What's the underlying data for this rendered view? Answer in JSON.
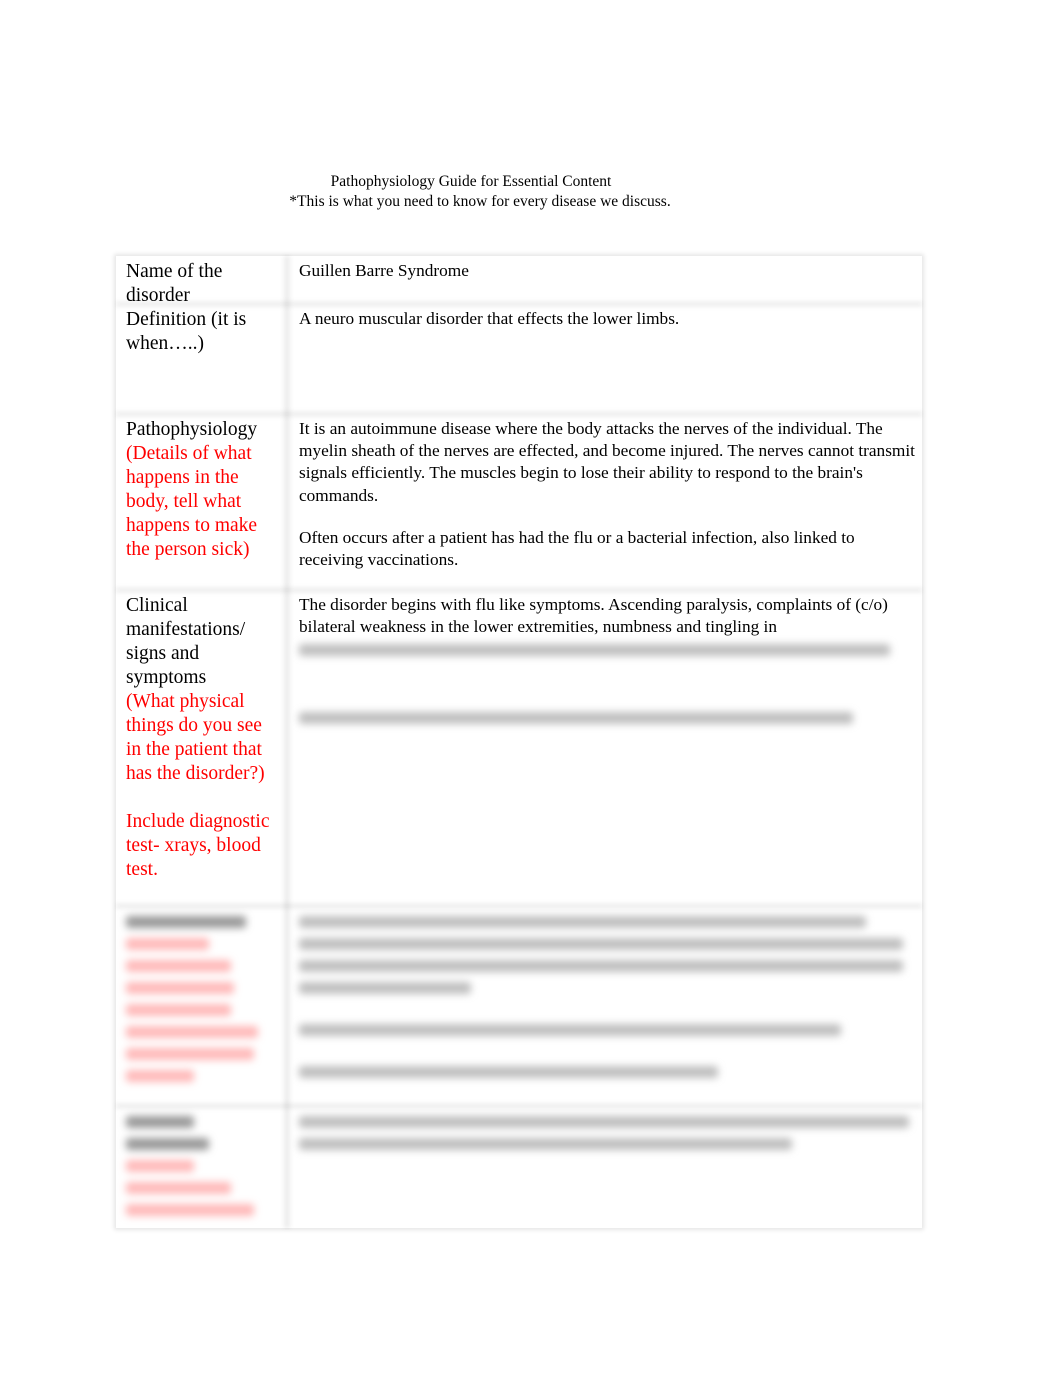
{
  "header": {
    "title": "Pathophysiology Guide for Essential Content",
    "subtitle": "*This is what you need to know for every disease we discuss."
  },
  "rows": [
    {
      "label": "Name of the disorder",
      "label_note": "",
      "value": [
        "Guillen Barre Syndrome"
      ]
    },
    {
      "label": "Definition (it is when…..)",
      "label_note": "",
      "value": [
        "A neuro muscular disorder that effects the lower limbs."
      ]
    },
    {
      "label": "Pathophysiology",
      "label_note": "(Details of what happens in the body, tell what happens to make the person sick)",
      "value": [
        "It is an autoimmune disease where the body attacks the nerves of the individual. The myelin sheath of the nerves are effected, and become injured. The nerves cannot transmit signals efficiently. The muscles begin to lose their ability to respond to the brain's commands.",
        "Often occurs after a patient has had the flu or a bacterial infection, also linked to receiving vaccinations."
      ]
    },
    {
      "label": "Clinical manifestations/ signs and symptoms",
      "label_note": "(What physical things do you see in the patient that has the disorder?)",
      "label_note2": "Include diagnostic test- xrays, blood test.",
      "value": [
        "The disorder begins with flu like symptoms.  Ascending paralysis, complaints of (c/o) bilateral weakness in the lower extremities, numbness and tingling in"
      ],
      "value_obscured": true
    },
    {
      "label_obscured": true,
      "value_obscured": true
    },
    {
      "label_obscured": true,
      "value_obscured": true
    }
  ],
  "colors": {
    "label_note": "#ff0000",
    "text": "#000000"
  }
}
